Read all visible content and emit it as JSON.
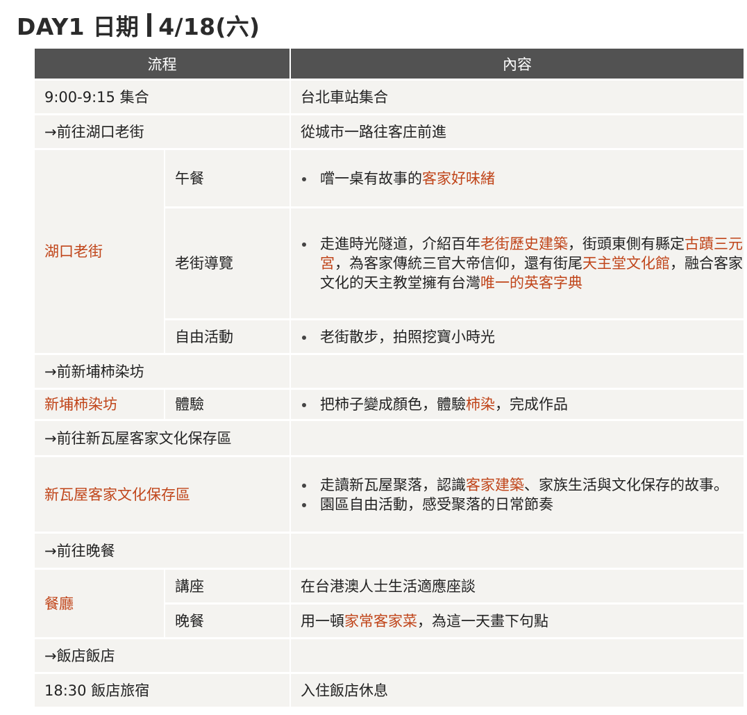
{
  "title": {
    "day": "DAY1 日期",
    "date": "4/18(六)"
  },
  "header": {
    "flow": "流程",
    "content": "內容"
  },
  "rows": {
    "r1": {
      "flow": "9:00-9:15 集合",
      "content": "台北車站集合"
    },
    "r2": {
      "flow": "→前往湖口老街",
      "content": "從城市一路往客庄前進"
    },
    "hukou": {
      "name": "湖口老街",
      "lunch": {
        "label": "午餐",
        "text1": "嚐一桌有故事的",
        "hl1": "客家好味緒"
      },
      "tour": {
        "label": "老街導覽",
        "t1": "走進時光隧道，介紹百年",
        "h1": "老街歷史建築",
        "t2": "，街頭東側有縣定",
        "h2": "古蹟三元宮",
        "t3": "，為客家傳統三官大帝信仰，還有街尾",
        "h3": "天主堂文化館",
        "t4": "，融合客家文化的天主教堂擁有台灣",
        "h4": "唯一的英客字典"
      },
      "free": {
        "label": "自由活動",
        "text": "老街散步，拍照挖寶小時光"
      }
    },
    "r4": {
      "flow": "→前新埔柿染坊"
    },
    "persimmon": {
      "name": "新埔柿染坊",
      "label": "體驗",
      "t1": "把柿子變成顏色，體驗",
      "h1": "柿染",
      "t2": "，完成作品"
    },
    "r6": {
      "flow": "→前往新瓦屋客家文化保存區"
    },
    "hsinwawu": {
      "name": "新瓦屋客家文化保存區",
      "b1_t1": "走讀新瓦屋聚落，認識",
      "b1_h1": "客家建築",
      "b1_t2": "、家族生活與文化保存的故事。",
      "b2": "園區自由活動，感受聚落的日常節奏"
    },
    "r8": {
      "flow": "→前往晚餐"
    },
    "restaurant": {
      "name": "餐廳",
      "talk": {
        "label": "講座",
        "text": "在台港澳人士生活適應座談"
      },
      "dinner": {
        "label": "晚餐",
        "t1": "用一頓",
        "h1": "家常客家菜",
        "t2": "，為這一天畫下句點"
      }
    },
    "r10": {
      "flow": "→飯店飯店"
    },
    "r11": {
      "flow": "18:30 飯店旅宿",
      "content": "入住飯店休息"
    }
  },
  "colors": {
    "header_bg": "#525252",
    "cell_bg": "#f4f3f0",
    "accent": "#c0451a"
  }
}
